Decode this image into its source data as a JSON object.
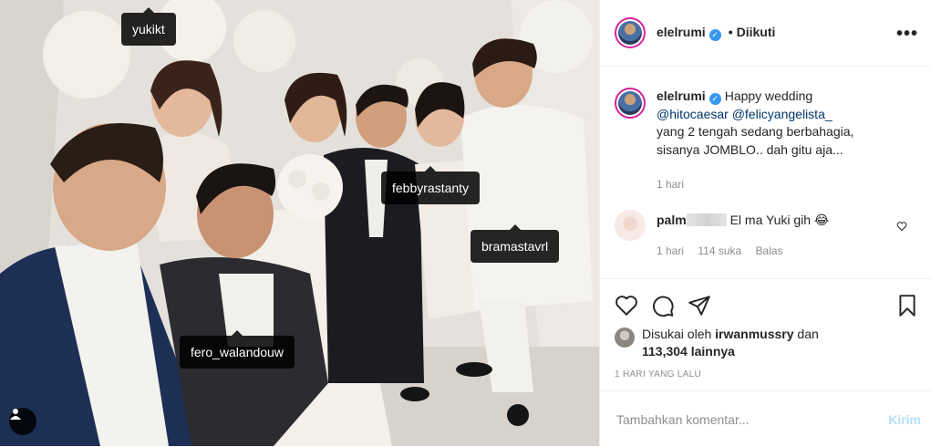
{
  "post": {
    "tags": [
      "yukikt",
      "febbyrastanty",
      "bramastavrl",
      "fero_walandouw"
    ],
    "user_badge_icon": "user-icon"
  },
  "header": {
    "username": "elelrumi",
    "verified_icon": "verified-badge-icon",
    "separator": "•",
    "follow_status": "Diikuti",
    "more_icon": "more-options-icon"
  },
  "caption": {
    "username": "elelrumi",
    "text_intro": "Happy wedding",
    "mention1": "@hitocaesar",
    "mention2": "@felicyangelista_",
    "text_rest": "yang 2 tengah sedang berbahagia, sisanya JOMBLO.. dah gitu aja...",
    "time": "1 hari"
  },
  "comment": {
    "username_visible": "palm",
    "text": "El ma Yuki gih 😂",
    "time": "1 hari",
    "likes": "114 suka",
    "reply": "Balas"
  },
  "actions": {
    "like_icon": "heart-icon",
    "comment_icon": "comment-icon",
    "share_icon": "share-icon",
    "save_icon": "bookmark-icon"
  },
  "likes": {
    "prefix": "Disukai oleh",
    "user": "irwanmussry",
    "and": "dan",
    "count": "113,304 lainnya"
  },
  "timestamp": "1 HARI YANG LALU",
  "add_comment": {
    "placeholder": "Tambahkan komentar...",
    "send": "Kirim"
  },
  "colors": {
    "accent_link": "#00376b",
    "verified": "#3897f0",
    "send_disabled": "#b2dffc",
    "meta": "#8e8e8e"
  }
}
